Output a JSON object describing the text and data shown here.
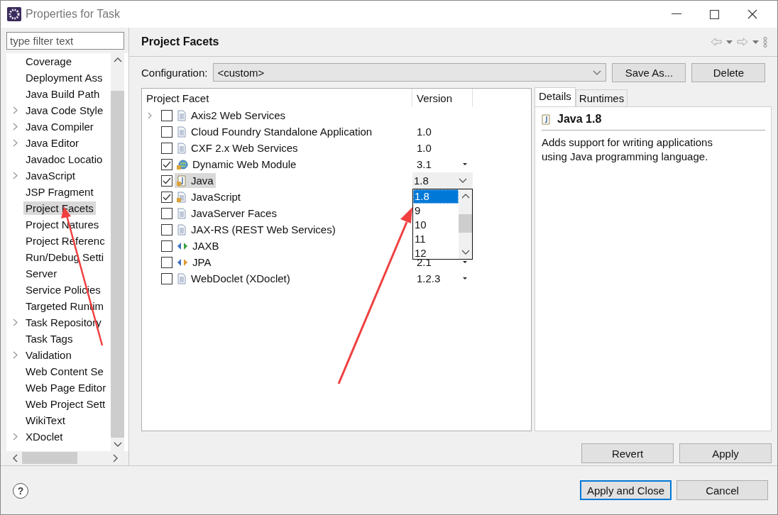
{
  "window": {
    "title": "Properties for Task"
  },
  "filter": {
    "placeholder": "type filter text"
  },
  "sidebar": {
    "items": [
      {
        "label": "Coverage",
        "expandable": false,
        "selected": false
      },
      {
        "label": "Deployment Ass",
        "expandable": false,
        "selected": false
      },
      {
        "label": "Java Build Path",
        "expandable": false,
        "selected": false
      },
      {
        "label": "Java Code Style",
        "expandable": true,
        "selected": false
      },
      {
        "label": "Java Compiler",
        "expandable": true,
        "selected": false
      },
      {
        "label": "Java Editor",
        "expandable": true,
        "selected": false
      },
      {
        "label": "Javadoc Locatio",
        "expandable": false,
        "selected": false
      },
      {
        "label": "JavaScript",
        "expandable": true,
        "selected": false
      },
      {
        "label": "JSP Fragment",
        "expandable": false,
        "selected": false
      },
      {
        "label": "Project Facets",
        "expandable": false,
        "selected": true
      },
      {
        "label": "Project Natures",
        "expandable": false,
        "selected": false
      },
      {
        "label": "Project Referenc",
        "expandable": false,
        "selected": false
      },
      {
        "label": "Run/Debug Setti",
        "expandable": false,
        "selected": false
      },
      {
        "label": "Server",
        "expandable": false,
        "selected": false
      },
      {
        "label": "Service Policies",
        "expandable": false,
        "selected": false
      },
      {
        "label": "Targeted Runtim",
        "expandable": false,
        "selected": false
      },
      {
        "label": "Task Repository",
        "expandable": true,
        "selected": false
      },
      {
        "label": "Task Tags",
        "expandable": false,
        "selected": false
      },
      {
        "label": "Validation",
        "expandable": true,
        "selected": false
      },
      {
        "label": "Web Content Se",
        "expandable": false,
        "selected": false
      },
      {
        "label": "Web Page Editor",
        "expandable": false,
        "selected": false
      },
      {
        "label": "Web Project Sett",
        "expandable": false,
        "selected": false
      },
      {
        "label": "WikiText",
        "expandable": false,
        "selected": false
      },
      {
        "label": "XDoclet",
        "expandable": true,
        "selected": false
      }
    ]
  },
  "page": {
    "title": "Project Facets",
    "configuration": {
      "label": "Configuration:",
      "value": "<custom>"
    },
    "config_buttons": [
      "Save As...",
      "Delete"
    ],
    "table": {
      "columns": [
        "Project Facet",
        "Version"
      ],
      "rows": [
        {
          "name": "Axis2 Web Services",
          "checked": false,
          "kind": "doc",
          "expandable": true,
          "selected": false
        },
        {
          "name": "Cloud Foundry Standalone Application",
          "checked": false,
          "kind": "doc",
          "expandable": false,
          "selected": false,
          "version": "1.0",
          "version_menu": false
        },
        {
          "name": "CXF 2.x Web Services",
          "checked": false,
          "kind": "doc",
          "expandable": false,
          "selected": false,
          "version": "1.0",
          "version_menu": false
        },
        {
          "name": "Dynamic Web Module",
          "checked": true,
          "kind": "globe",
          "expandable": false,
          "selected": false,
          "version": "3.1",
          "version_menu": true
        },
        {
          "name": "Java",
          "checked": true,
          "kind": "java",
          "expandable": false,
          "selected": true,
          "version": "1.8",
          "version_menu": true
        },
        {
          "name": "JavaScript",
          "checked": true,
          "kind": "doc-locked",
          "expandable": false,
          "selected": false
        },
        {
          "name": "JavaServer Faces",
          "checked": false,
          "kind": "doc",
          "expandable": false,
          "selected": false
        },
        {
          "name": "JAX-RS (REST Web Services)",
          "checked": false,
          "kind": "doc",
          "expandable": false,
          "selected": false
        },
        {
          "name": "JAXB",
          "checked": false,
          "kind": "arrows-green",
          "expandable": false,
          "selected": false
        },
        {
          "name": "JPA",
          "checked": false,
          "kind": "arrows-orange",
          "expandable": false,
          "selected": false,
          "version": "2.1",
          "version_menu": true
        },
        {
          "name": "WebDoclet (XDoclet)",
          "checked": false,
          "kind": "doc",
          "expandable": false,
          "selected": false,
          "version": "1.2.3",
          "version_menu": true
        }
      ]
    },
    "version_list": [
      {
        "label": "1.8",
        "selected": true
      },
      {
        "label": "9",
        "selected": false
      },
      {
        "label": "10",
        "selected": false
      },
      {
        "label": "11",
        "selected": false
      },
      {
        "label": "12",
        "selected": false
      }
    ],
    "details": {
      "tabs": [
        {
          "label": "Details",
          "selected": true
        },
        {
          "label": "Runtimes",
          "selected": false
        }
      ],
      "title": "Java 1.8",
      "text": "Adds support for writing applications using Java programming language."
    },
    "page_buttons": [
      "Revert",
      "Apply"
    ]
  },
  "help": "?",
  "buttons": [
    {
      "label": "Apply and Close",
      "default": true
    },
    {
      "label": "Cancel",
      "default": false
    }
  ]
}
